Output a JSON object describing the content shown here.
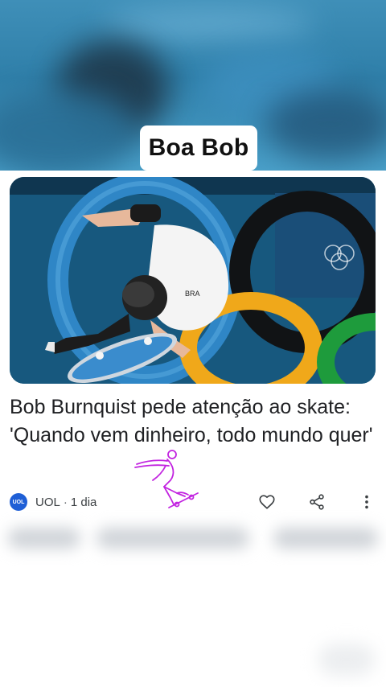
{
  "story": {
    "caption": "Boa Bob"
  },
  "article": {
    "headline": "Bob Burnquist pede atenção ao skate: 'Quando vem dinheiro, todo mundo quer'",
    "source": {
      "name": "UOL",
      "logo_text": "UOL"
    },
    "separator": "·",
    "time": "1 dia",
    "photo_shirt_text": "BRA"
  },
  "actions": [
    {
      "name": "like-button",
      "icon": "heart-icon"
    },
    {
      "name": "share-button",
      "icon": "share-icon"
    },
    {
      "name": "more-button",
      "icon": "more-vertical-icon"
    }
  ],
  "colors": {
    "accent_sketch": "#c224e0",
    "source_logo": "#1f5fd6",
    "text": "#202124"
  }
}
